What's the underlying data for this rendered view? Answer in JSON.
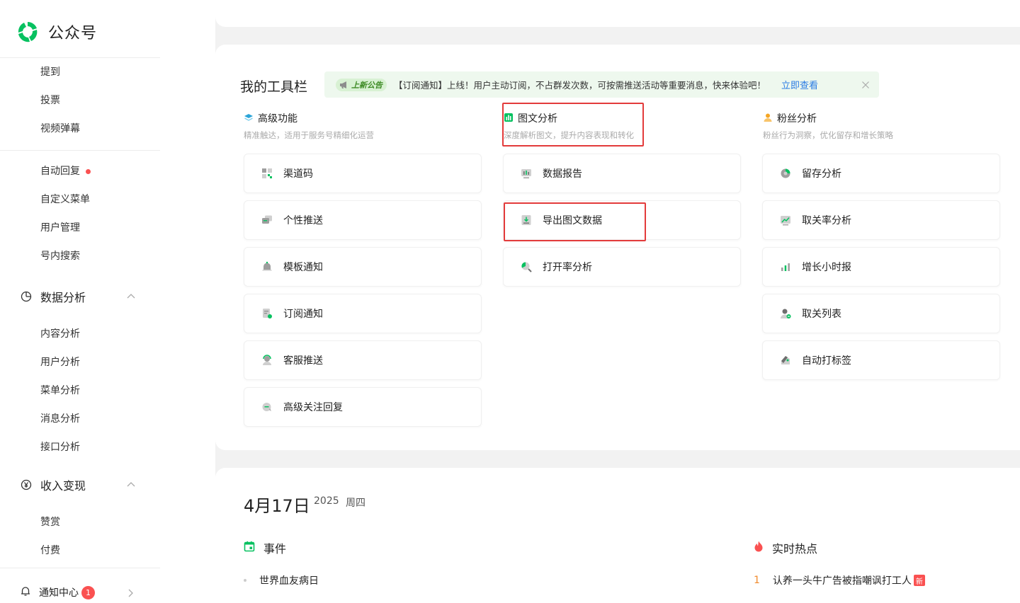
{
  "app": {
    "title": "公众号"
  },
  "sidebar": {
    "items_top": [
      {
        "label": "提到"
      },
      {
        "label": "投票"
      },
      {
        "label": "视频弹幕"
      }
    ],
    "items_mid": [
      {
        "label": "自动回复",
        "has_dot": true
      },
      {
        "label": "自定义菜单"
      },
      {
        "label": "用户管理"
      },
      {
        "label": "号内搜索"
      }
    ],
    "groups": [
      {
        "label": "数据分析",
        "icon": "pie-chart-icon",
        "expanded": true,
        "items": [
          {
            "label": "内容分析"
          },
          {
            "label": "用户分析"
          },
          {
            "label": "菜单分析"
          },
          {
            "label": "消息分析"
          },
          {
            "label": "接口分析"
          }
        ]
      },
      {
        "label": "收入变现",
        "icon": "yen-icon",
        "expanded": true,
        "items": [
          {
            "label": "赞赏"
          },
          {
            "label": "付费"
          }
        ]
      }
    ],
    "notification": {
      "label": "通知中心",
      "count": "1"
    }
  },
  "toolbar": {
    "title": "我的工具栏",
    "notice": {
      "tag": "上新公告",
      "text": "【订阅通知】上线！用户主动订阅，不占群发次数，可按需推送活动等重要消息，快来体验吧！",
      "link": "立即查看"
    },
    "columns": [
      {
        "title": "高级功能",
        "icon": "layers-icon",
        "subtitle": "精准触达，适用于服务号精细化运营",
        "tools": [
          {
            "label": "渠道码"
          },
          {
            "label": "个性推送"
          },
          {
            "label": "模板通知"
          },
          {
            "label": "订阅通知"
          },
          {
            "label": "客服推送"
          },
          {
            "label": "高级关注回复"
          }
        ]
      },
      {
        "title": "图文分析",
        "icon": "bar-chart-icon",
        "subtitle": "深度解析图文，提升内容表现和转化",
        "tools": [
          {
            "label": "数据报告"
          },
          {
            "label": "导出图文数据"
          },
          {
            "label": "打开率分析"
          }
        ]
      },
      {
        "title": "粉丝分析",
        "icon": "user-icon",
        "subtitle": "粉丝行为洞察，优化留存和增长策略",
        "tools": [
          {
            "label": "留存分析"
          },
          {
            "label": "取关率分析"
          },
          {
            "label": "增长小时报"
          },
          {
            "label": "取关列表"
          },
          {
            "label": "自动打标签"
          }
        ]
      }
    ]
  },
  "calendar": {
    "date": "4月17日",
    "year": "2025",
    "weekday": "周四",
    "events_title": "事件",
    "events": [
      {
        "label": "世界血友病日"
      }
    ],
    "hot_title": "实时热点",
    "hot": [
      {
        "rank": "1",
        "label": "认养一头牛广告被指嘲讽打工人",
        "tag": "新"
      }
    ]
  },
  "colors": {
    "brand_green": "#07c160",
    "accent_blue": "#2a7be4",
    "alert_red": "#fa5151",
    "highlight_red": "#e33b3b"
  }
}
